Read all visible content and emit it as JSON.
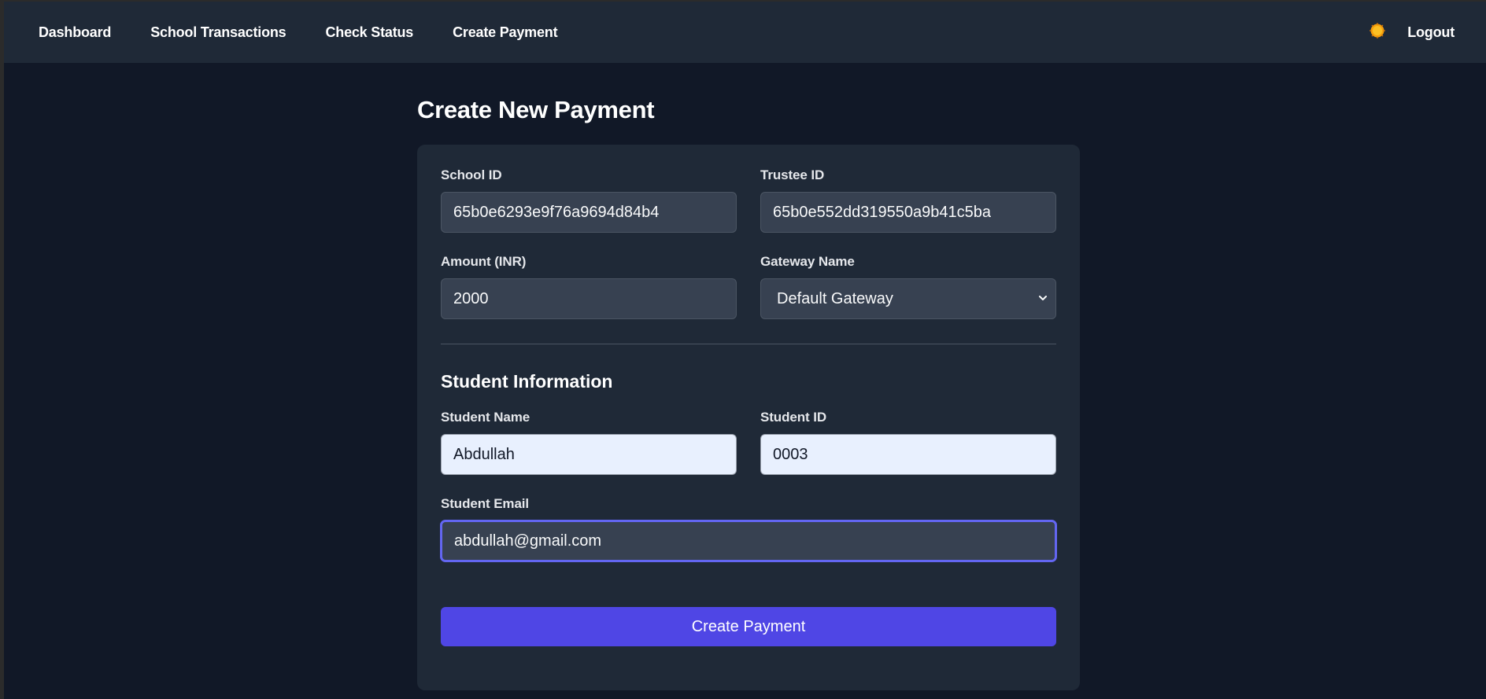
{
  "nav": {
    "links": [
      "Dashboard",
      "School Transactions",
      "Check Status",
      "Create Payment"
    ],
    "logout_label": "Logout"
  },
  "page": {
    "title": "Create New Payment"
  },
  "form": {
    "school_id": {
      "label": "School ID",
      "value": "65b0e6293e9f76a9694d84b4"
    },
    "trustee_id": {
      "label": "Trustee ID",
      "value": "65b0e552dd319550a9b41c5ba"
    },
    "amount": {
      "label": "Amount (INR)",
      "value": "2000"
    },
    "gateway": {
      "label": "Gateway Name",
      "selected": "Default Gateway"
    },
    "student_section_title": "Student Information",
    "student_name": {
      "label": "Student Name",
      "value": "Abdullah"
    },
    "student_id": {
      "label": "Student ID",
      "value": "0003"
    },
    "student_email": {
      "label": "Student Email",
      "value": "abdullah@gmail.com"
    },
    "submit_label": "Create Payment"
  },
  "colors": {
    "background": "#111827",
    "card": "#1f2937",
    "accent": "#4f46e5",
    "input": "#374151",
    "autofill": "#e8f0fe"
  },
  "icons": {
    "theme_toggle": "sun-icon",
    "select_arrow": "chevron-down-icon"
  }
}
